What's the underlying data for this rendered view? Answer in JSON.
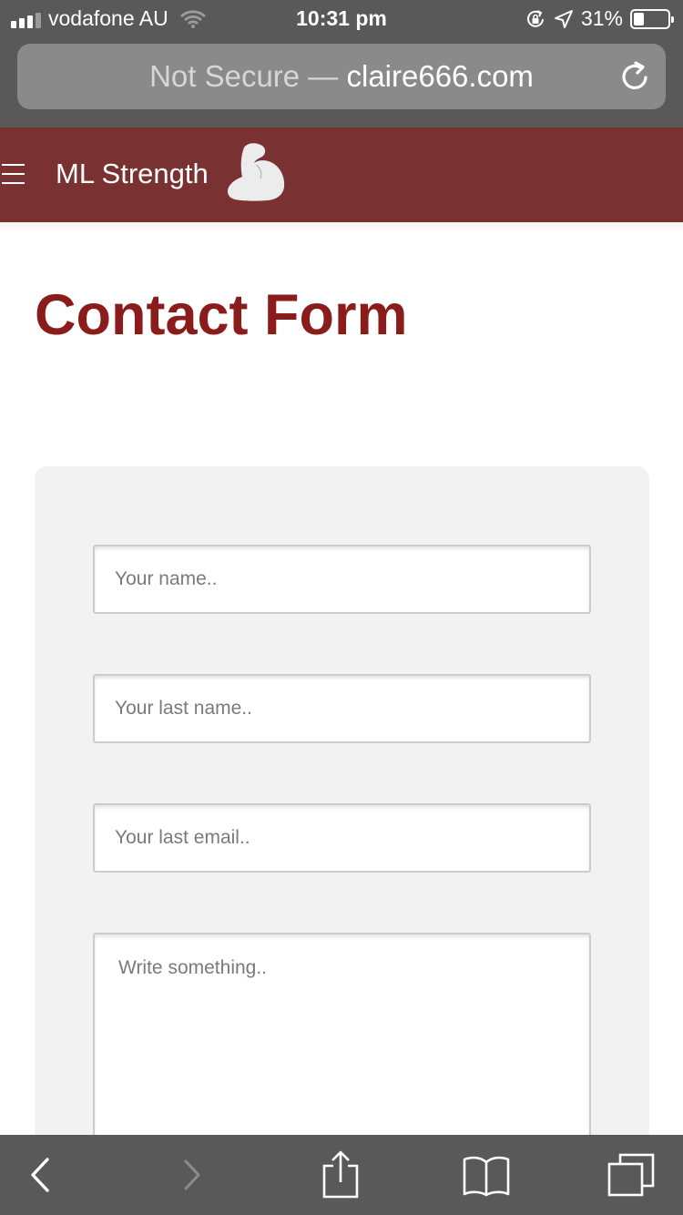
{
  "status_bar": {
    "carrier": "vodafone AU",
    "time": "10:31 pm",
    "battery_percent_label": "31%",
    "battery_level": 0.31
  },
  "url_bar": {
    "security_label": "Not Secure —",
    "domain": "claire666.com"
  },
  "site_header": {
    "brand": "ML Strength",
    "menu_icon": "hamburger-icon",
    "logo_icon": "flexed-bicep-icon"
  },
  "page": {
    "title": "Contact Form"
  },
  "form": {
    "first_name_placeholder": "Your name..",
    "last_name_placeholder": "Your last name..",
    "email_placeholder": "Your last email..",
    "message_placeholder": "Write something.."
  },
  "toolbar": {
    "back_icon": "chevron-left-icon",
    "forward_icon": "chevron-right-icon",
    "share_icon": "share-icon",
    "bookmarks_icon": "book-icon",
    "tabs_icon": "tabs-icon"
  },
  "colors": {
    "header_bg": "#7a3131",
    "title": "#8b1c1c",
    "browser_chrome": "#595959",
    "form_panel": "#f2f2f2"
  }
}
